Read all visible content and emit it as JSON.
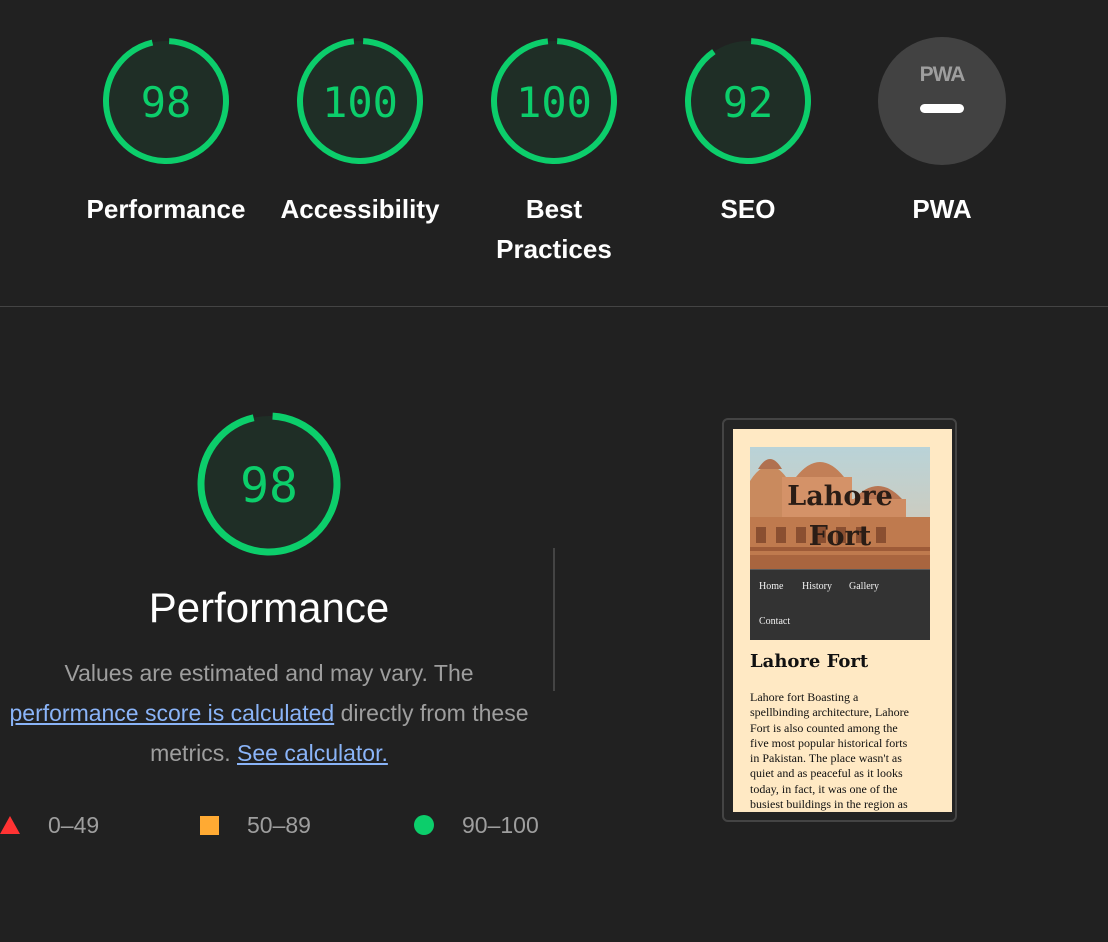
{
  "colors": {
    "background": "#212121",
    "pass": "#0cce6b",
    "average": "#ffaa33",
    "fail": "#ff3333",
    "link": "#8ab4f8",
    "muted_text": "#9e9e9e",
    "pwa_gauge": "#424242"
  },
  "categories": [
    {
      "id": "performance",
      "score": "98",
      "score_value": 98,
      "label": "Performance"
    },
    {
      "id": "accessibility",
      "score": "100",
      "score_value": 100,
      "label": "Accessibility"
    },
    {
      "id": "best-practices",
      "score": "100",
      "score_value": 100,
      "label_line1": "Best",
      "label_line2": "Practices"
    },
    {
      "id": "seo",
      "score": "92",
      "score_value": 92,
      "label": "SEO"
    },
    {
      "id": "pwa",
      "logo_text": "PWA",
      "icon": "pwa-dash-icon",
      "label": "PWA"
    }
  ],
  "performance_section": {
    "score": "98",
    "score_value": 98,
    "title": "Performance",
    "desc_part1": "Values are estimated and may vary. The",
    "link_score": "performance score is calculated",
    "desc_part2": "directly from these metrics.",
    "link_calculator": "See calculator."
  },
  "legend": [
    {
      "icon": "fail-triangle-icon",
      "label": "0–49"
    },
    {
      "icon": "average-square-icon",
      "label": "50–89"
    },
    {
      "icon": "pass-circle-icon",
      "label": "90–100"
    }
  ],
  "screenshot": {
    "hero_title_line1": "Lahore",
    "hero_title_line2": "Fort",
    "nav": [
      "Home",
      "History",
      "Gallery",
      "Contact"
    ],
    "heading": "Lahore Fort",
    "body_lines": [
      "Lahore fort Boasting a",
      "spellbinding architecture, Lahore",
      "Fort is also counted among the",
      "five most popular historical forts",
      "in Pakistan. The place wasn't as",
      "quiet and as peaceful as it looks",
      "today, in fact, it was one of the",
      "busiest buildings in the region as"
    ]
  }
}
